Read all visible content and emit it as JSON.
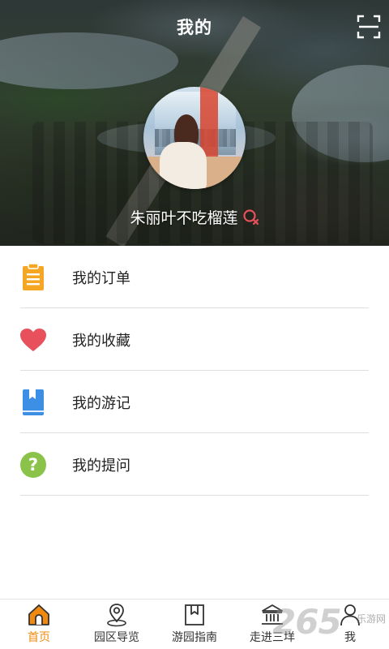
{
  "header": {
    "title": "我的",
    "scan_icon": "scan-icon"
  },
  "profile": {
    "avatar": "profile-photo",
    "username": "朱丽叶不吃榴莲",
    "gender_icon": "female-gender-icon",
    "gender_color": "#e8505b"
  },
  "menu": {
    "items": [
      {
        "label": "我的订单",
        "icon": "clipboard-icon",
        "color": "#f5a623"
      },
      {
        "label": "我的收藏",
        "icon": "heart-icon",
        "color": "#e8505b"
      },
      {
        "label": "我的游记",
        "icon": "book-icon",
        "color": "#3d8fe6"
      },
      {
        "label": "我的提问",
        "icon": "question-icon",
        "color": "#8bc34a"
      }
    ]
  },
  "tabbar": {
    "accent": "#f08a0f",
    "tabs": [
      {
        "label": "首页",
        "icon": "home-icon",
        "active": true
      },
      {
        "label": "园区导览",
        "icon": "map-pin-icon",
        "active": false
      },
      {
        "label": "游园指南",
        "icon": "bookmark-icon",
        "active": false
      },
      {
        "label": "走进三垟",
        "icon": "museum-icon",
        "active": false
      },
      {
        "label": "我",
        "icon": "user-icon",
        "active": false
      }
    ]
  },
  "watermark": {
    "number": "265",
    "text": "乐游网"
  }
}
